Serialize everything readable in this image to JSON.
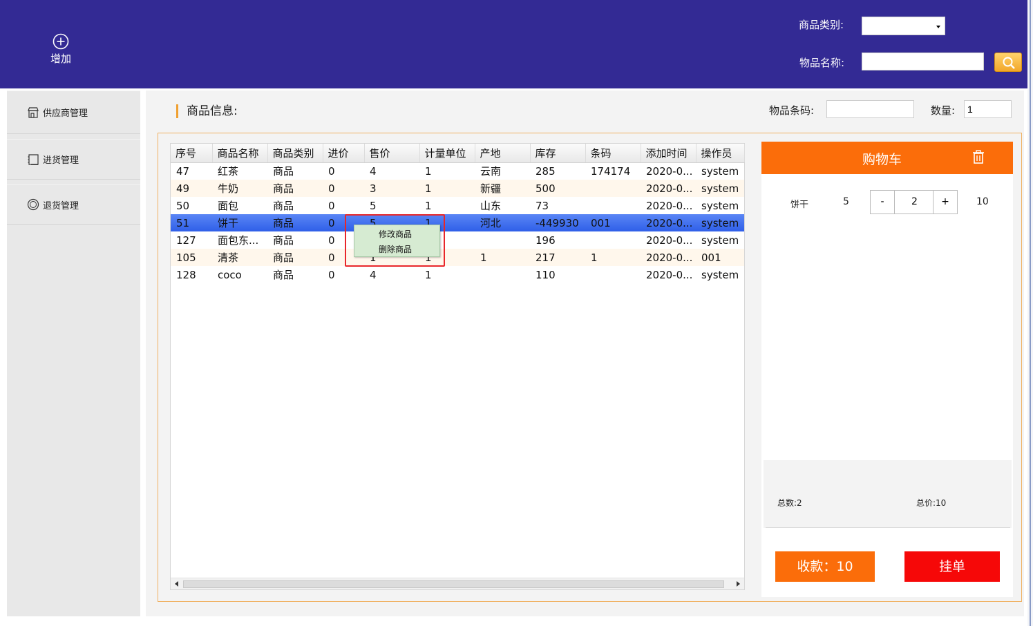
{
  "header": {
    "add_label": "增加",
    "category_label": "商品类别:",
    "category_value": "",
    "name_label": "物品名称:",
    "name_value": ""
  },
  "sidebar": {
    "items": [
      {
        "label": "供应商管理",
        "icon": "store-icon"
      },
      {
        "label": "进货管理",
        "icon": "clipboard-icon"
      },
      {
        "label": "退货管理",
        "icon": "return-icon"
      }
    ]
  },
  "toolbar": {
    "section_title": "商品信息:",
    "barcode_label": "物品条码:",
    "barcode_value": "",
    "qty_label": "数量:",
    "qty_value": "1"
  },
  "table": {
    "columns": [
      "序号",
      "商品名称",
      "商品类别",
      "进价",
      "售价",
      "计量单位",
      "产地",
      "库存",
      "条码",
      "添加时间",
      "操作员"
    ],
    "rows": [
      [
        "47",
        "红茶",
        "商品",
        "0",
        "4",
        "1",
        "云南",
        "285",
        "174174",
        "2020-0...",
        "system"
      ],
      [
        "49",
        "牛奶",
        "商品",
        "0",
        "3",
        "1",
        "新疆",
        "500",
        "",
        "2020-0...",
        "system"
      ],
      [
        "50",
        "面包",
        "商品",
        "0",
        "5",
        "1",
        "山东",
        "73",
        "",
        "2020-0...",
        "system"
      ],
      [
        "51",
        "饼干",
        "商品",
        "0",
        "5",
        "1",
        "河北",
        "-449930",
        "001",
        "2020-0...",
        "system"
      ],
      [
        "127",
        "面包东...",
        "商品",
        "0",
        "",
        "",
        "",
        "196",
        "",
        "2020-0...",
        "system"
      ],
      [
        "105",
        "清茶",
        "商品",
        "0",
        "1",
        "1",
        "1",
        "217",
        "1",
        "2020-0...",
        "001"
      ],
      [
        "128",
        "coco",
        "商品",
        "0",
        "4",
        "1",
        "",
        "110",
        "",
        "2020-0...",
        "system"
      ]
    ],
    "selected_row": 3
  },
  "context_menu": {
    "items": [
      "修改商品",
      "删除商品"
    ]
  },
  "cart": {
    "title": "购物车",
    "items": [
      {
        "name": "饼干",
        "price": "5",
        "qty": "2",
        "subtotal": "10"
      }
    ],
    "minus": "-",
    "plus": "+",
    "total_count": "总数:2",
    "total_price": "总价:10",
    "pay_label": "收款：10",
    "hold_label": "挂单"
  },
  "colors": {
    "header_bg": "#332a94",
    "accent_orange": "#fb6d0a",
    "hold_red": "#f60808",
    "selected_row": "#3a68ee"
  }
}
